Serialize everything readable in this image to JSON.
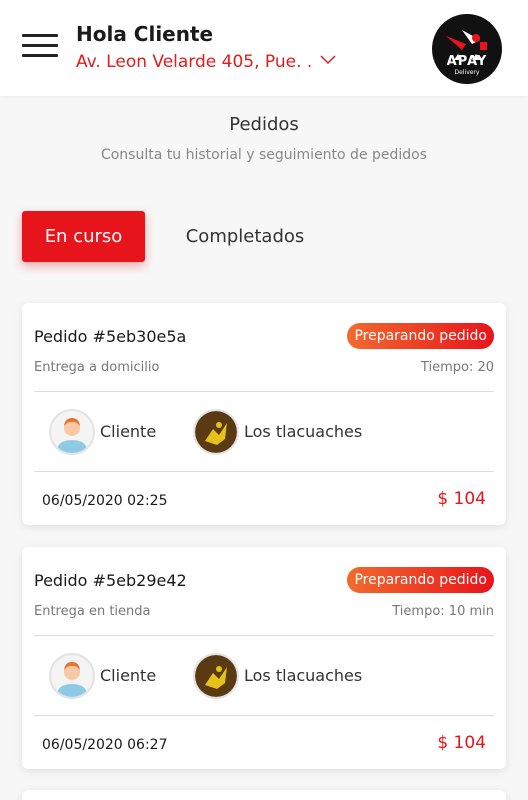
{
  "header": {
    "greeting": "Hola Cliente",
    "address": "Av. Leon Velarde 405, Pue. .",
    "logo_text": "APAY",
    "logo_sub": "Delivery"
  },
  "section": {
    "title": "Pedidos",
    "subtitle": "Consulta tu historial y seguimiento de pedidos"
  },
  "tabs": [
    {
      "label": "En curso",
      "active": true
    },
    {
      "label": "Completados",
      "active": false
    }
  ],
  "orders": [
    {
      "id": "Pedido #5eb30e5a",
      "status": "Preparando pedido",
      "delivery": "Entrega a domicilio",
      "time": "Tiempo: 20",
      "customer": "Cliente",
      "store": "Los tlacuaches",
      "date": "06/05/2020 02:25",
      "price": "$ 104"
    },
    {
      "id": "Pedido #5eb29e42",
      "status": "Preparando pedido",
      "delivery": "Entrega en tienda",
      "time": "Tiempo: 10 min",
      "customer": "Cliente",
      "store": "Los tlacuaches",
      "date": "06/05/2020 06:27",
      "price": "$ 104"
    }
  ],
  "colors": {
    "accent": "#e8141b",
    "status_gradient_start": "#f26a2e",
    "address": "#e31b1b"
  },
  "icons": [
    "menu-icon",
    "chevron-down-icon",
    "customer-avatar-icon",
    "store-avatar-icon"
  ]
}
